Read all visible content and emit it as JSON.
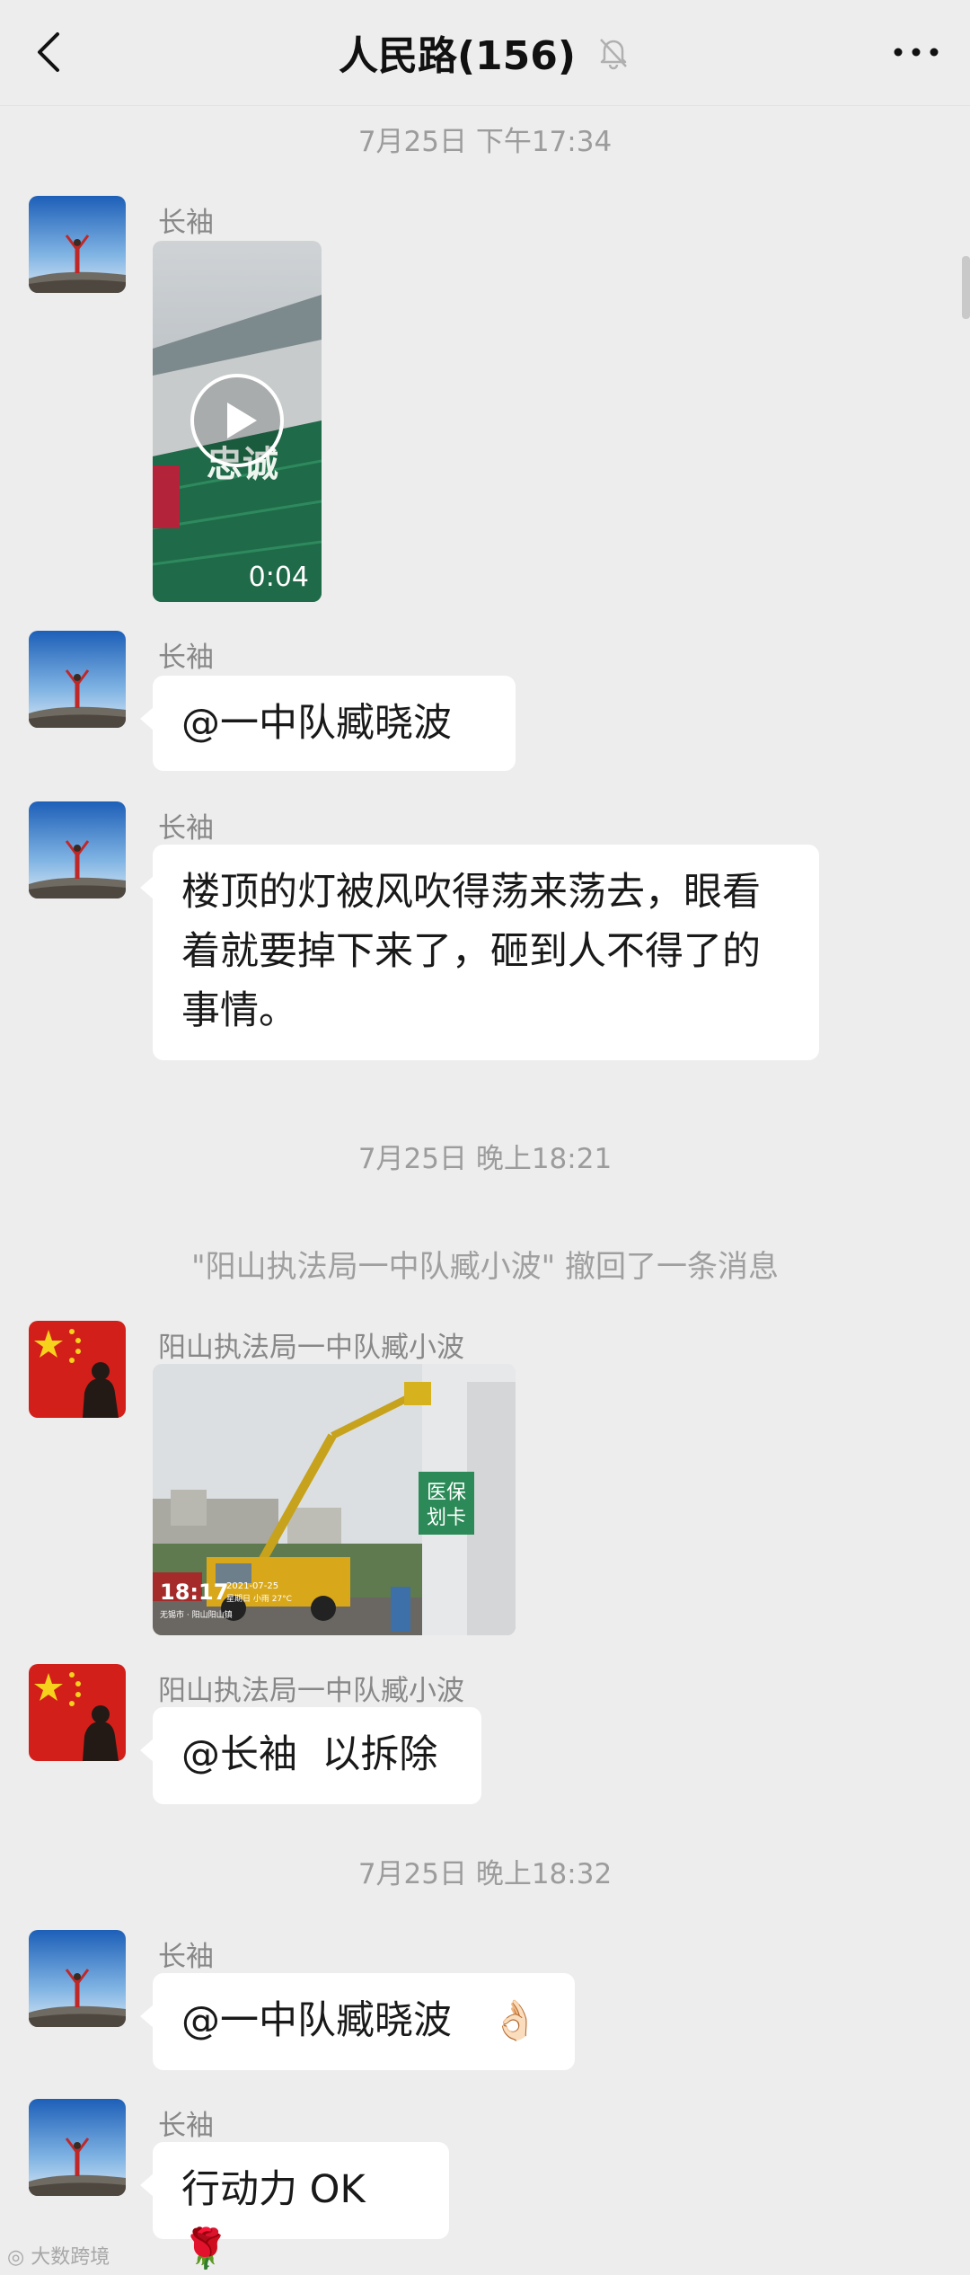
{
  "header": {
    "title": "人民路(156)",
    "back_icon": "chevron-left-icon",
    "mute_icon": "bell-off-icon",
    "more_icon": "more-dots-icon"
  },
  "messages": {
    "time1": "7月25日 下午17:34",
    "m1": {
      "sender": "长袖",
      "video_duration": "0:04",
      "video_sign_text": "忠诚"
    },
    "m2": {
      "sender": "长袖",
      "text": "@一中队臧晓波"
    },
    "m3": {
      "sender": "长袖",
      "line1": "楼顶的灯被风吹得荡来荡去，眼看",
      "line2": "着就要掉下来了，砸到人不得了的",
      "line3": "事情。"
    },
    "time2": "7月25日 晚上18:21",
    "recall": "\"阳山执法局一中队臧小波\" 撤回了一条消息",
    "m4": {
      "sender": "阳山执法局一中队臧小波",
      "photo_time": "18:17",
      "photo_date": "2021-07-25",
      "photo_weather": "星期日 小雨 27°C",
      "photo_location": "无锡市 · 阳山阳山镇",
      "sign_line1": "医保",
      "sign_line2": "划卡"
    },
    "m5": {
      "sender": "阳山执法局一中队臧小波",
      "text": "@长袖  以拆除"
    },
    "time3": "7月25日 晚上18:32",
    "m6": {
      "sender": "长袖",
      "text": "@一中队臧晓波",
      "emoji": "👌🏻"
    },
    "m7": {
      "sender": "长袖",
      "text": "行动力 OK",
      "emoji": "🌹"
    }
  },
  "watermark": "大数跨境",
  "colors": {
    "background": "#ededed",
    "bubble": "#ffffff",
    "timestamp": "#9c9c9c",
    "sender": "#888888"
  }
}
